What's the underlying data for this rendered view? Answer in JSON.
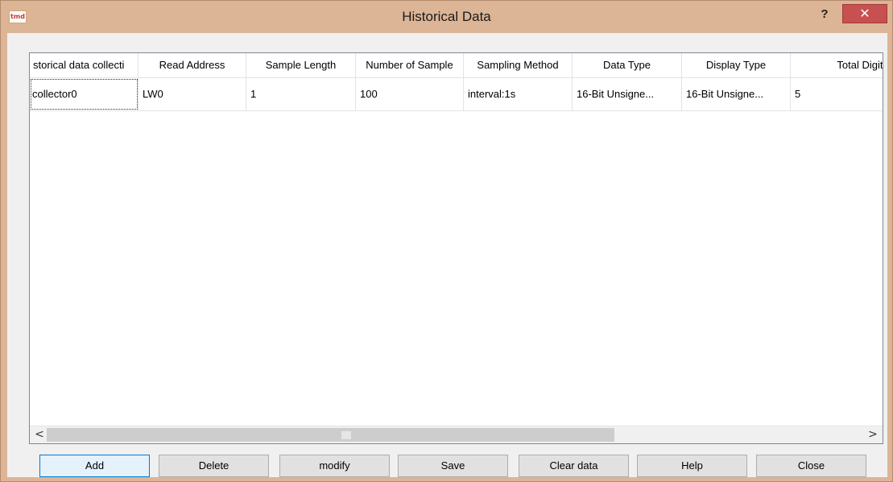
{
  "window": {
    "title": "Historical Data",
    "app_icon_text": "tmd",
    "help_label": "?",
    "close_label": "✕"
  },
  "table": {
    "headers": [
      "storical data collecti",
      "Read Address",
      "Sample Length",
      "Number of Sample",
      "Sampling Method",
      "Data Type",
      "Display Type",
      "Total Digits"
    ],
    "rows": [
      [
        "collector0",
        "LW0",
        "1",
        "100",
        "interval:1s",
        "16-Bit Unsigne...",
        "16-Bit Unsigne...",
        "5"
      ]
    ]
  },
  "scrollbar": {
    "left_arrow": "<",
    "right_arrow": ">"
  },
  "buttons": {
    "add": "Add",
    "delete": "Delete",
    "modify": "modify",
    "save": "Save",
    "clear": "Clear data",
    "help": "Help",
    "close": "Close"
  },
  "colors": {
    "title_bar": "#dcb596",
    "close_button": "#c75050",
    "default_button_border": "#0078d7"
  }
}
